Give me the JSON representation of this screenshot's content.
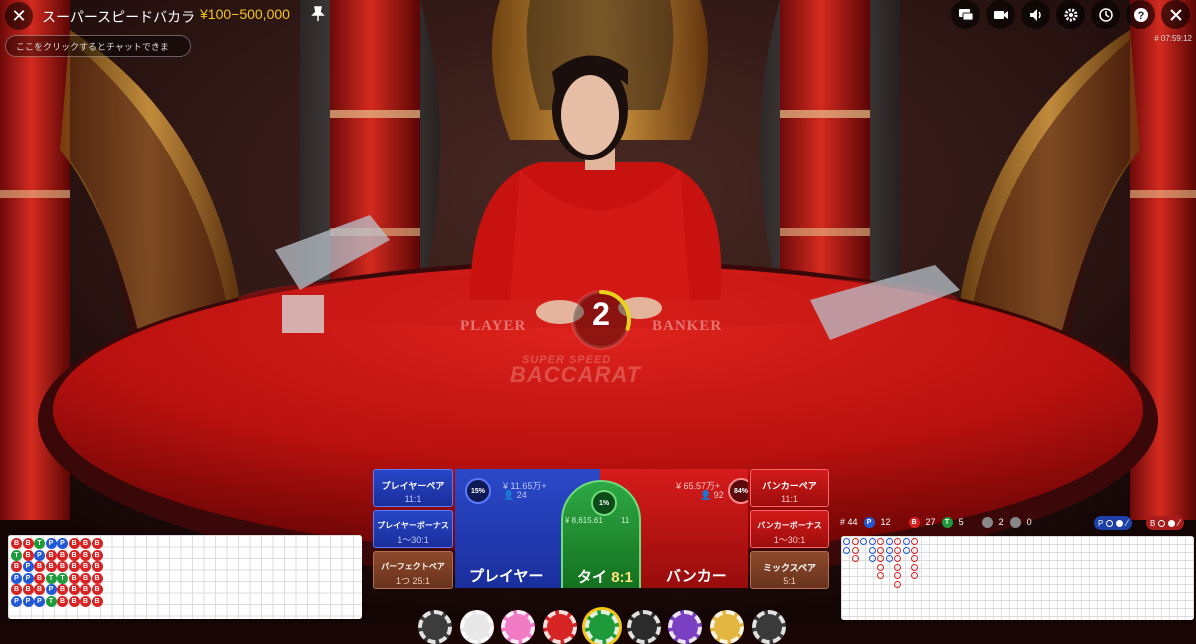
{
  "header": {
    "title": "スーパースピードバカラ",
    "limits": "¥100−500,000",
    "chat_placeholder": "ここをクリックするとチャットできま",
    "round_id": "# 07:59:12"
  },
  "toolbar": {
    "icons": [
      "chat-icon",
      "video-icon",
      "volume-icon",
      "settings-icon",
      "history-icon",
      "help-icon",
      "close-icon"
    ]
  },
  "timer": {
    "value": "2",
    "remaining_fraction": 0.3
  },
  "table": {
    "player_text": "PLAYER",
    "banker_text": "BANKER",
    "brand_sub": "SUPER SPEED",
    "brand_main": "BACCARAT"
  },
  "bets": {
    "player_pair": {
      "label": "プレイヤーペア",
      "odds": "11:1"
    },
    "player_bonus": {
      "label": "プレイヤーボーナス",
      "odds": "1〜30:1"
    },
    "perfect_pair": {
      "label": "パーフェクトペア",
      "odds": "1つ 25:1"
    },
    "player": {
      "label": "プレイヤー",
      "percent": "15%",
      "amount": "¥ 11.65万+",
      "players": "24"
    },
    "tie": {
      "label": "タイ",
      "odds": "8:1",
      "percent": "1%",
      "amount": "¥ 8,615.61",
      "players": "11"
    },
    "banker": {
      "label": "バンカー",
      "percent": "84%",
      "amount": "¥ 65.57万+",
      "players": "92"
    },
    "banker_pair": {
      "label": "バンカーペア",
      "odds": "11:1"
    },
    "banker_bonus": {
      "label": "バンカーボーナス",
      "odds": "1〜30:1"
    },
    "mix_pair": {
      "label": "ミックスペア",
      "odds": "5:1"
    }
  },
  "stats": {
    "round": "# 44",
    "player_wins": "12",
    "banker_wins": "27",
    "ties": "5",
    "player_pairs": "2",
    "banker_pairs": "0",
    "p_letter": "P",
    "b_letter": "B",
    "t_letter": "T"
  },
  "bead_road": {
    "columns": [
      [
        "B",
        "T",
        "B",
        "P",
        "B",
        "P"
      ],
      [
        "B",
        "B",
        "P",
        "P",
        "B",
        "P"
      ],
      [
        "T",
        "P",
        "B",
        "B",
        "B",
        "P"
      ],
      [
        "P",
        "B",
        "B",
        "T",
        "P",
        "T"
      ],
      [
        "P",
        "B",
        "B",
        "T",
        "B",
        "B"
      ],
      [
        "B",
        "B",
        "B",
        "B",
        "B",
        "B"
      ],
      [
        "B",
        "B",
        "B",
        "B",
        "B",
        "B"
      ],
      [
        "B",
        "B",
        "B",
        "B",
        "B",
        "B"
      ]
    ],
    "colors": {
      "P": "#2257d6",
      "B": "#d62323",
      "T": "#1e9a3a"
    }
  },
  "big_road_colors": {
    "player": "#2257d6",
    "banker": "#d62323",
    "tie": "#1e9a3a"
  },
  "chips": [
    "#3c3c3c",
    "#e8e8e8",
    "#f07ac4",
    "#d62323",
    "#1e9a3a",
    "#2b2b2b",
    "#7b3fc4",
    "#e2b640",
    "#3a3a3a"
  ]
}
